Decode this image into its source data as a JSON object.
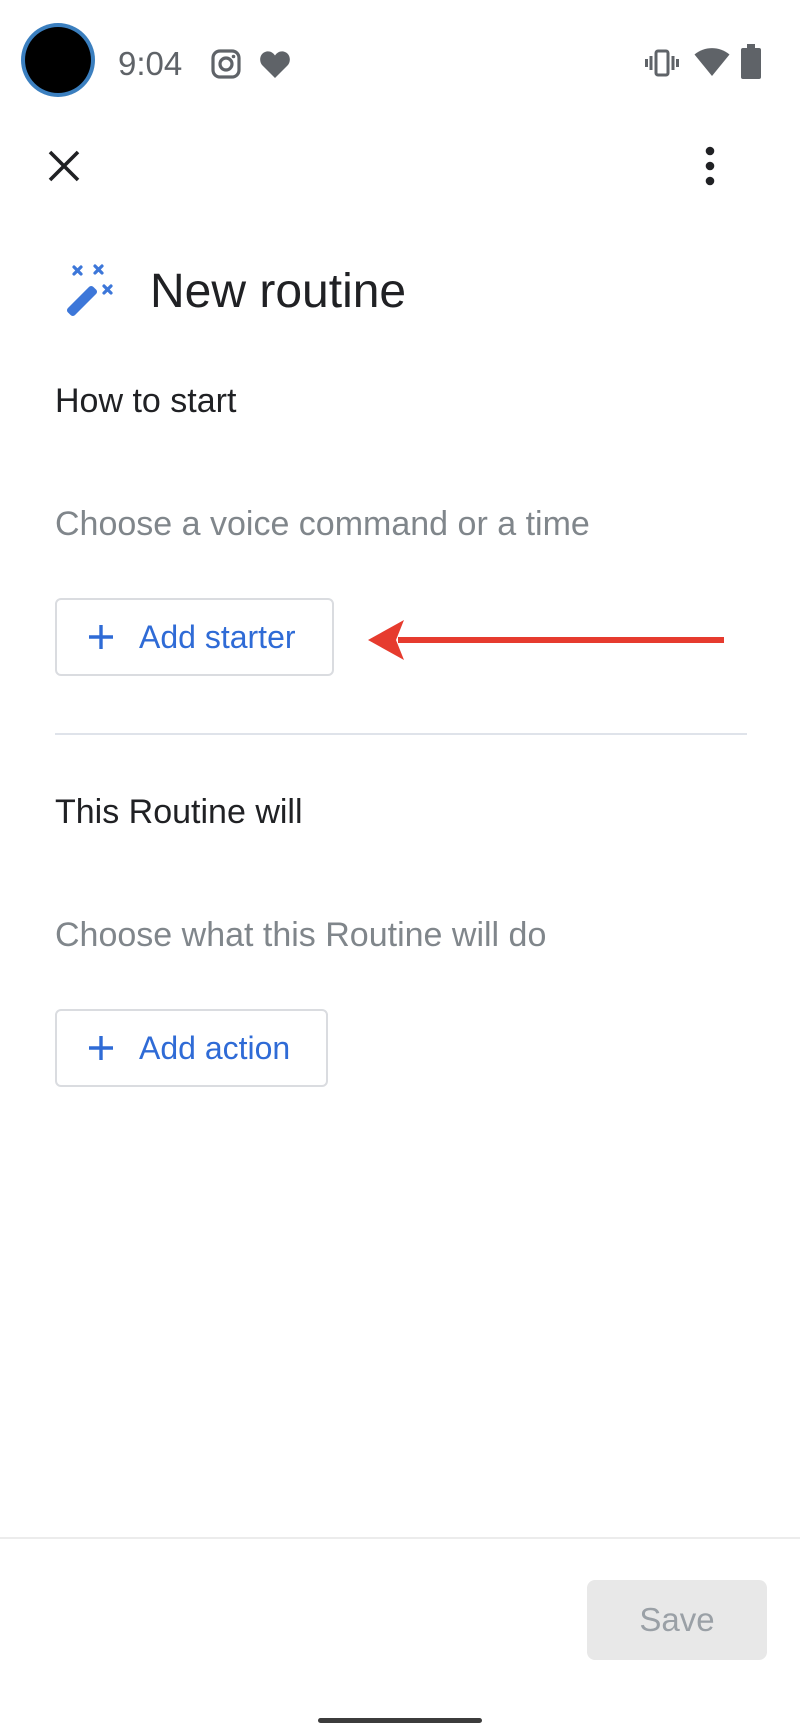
{
  "status_bar": {
    "time": "9:04",
    "icons": [
      "instagram-icon",
      "heart-icon",
      "vibrate-icon",
      "wifi-icon",
      "battery-icon"
    ]
  },
  "toolbar": {
    "close_icon": "close-icon",
    "menu_icon": "more-vert-icon"
  },
  "header": {
    "icon": "magic-wand-icon",
    "title": "New routine"
  },
  "starter_section": {
    "heading": "How to start",
    "hint": "Choose a voice command or a time",
    "button_label": "Add starter"
  },
  "action_section": {
    "heading": "This Routine will",
    "hint": "Choose what this Routine will do",
    "button_label": "Add action"
  },
  "footer": {
    "save_label": "Save"
  },
  "colors": {
    "accent": "#2f6bd6",
    "annotation_arrow": "#e63b2e",
    "hint_text": "#80868b",
    "save_disabled_bg": "#e8e8e8"
  }
}
